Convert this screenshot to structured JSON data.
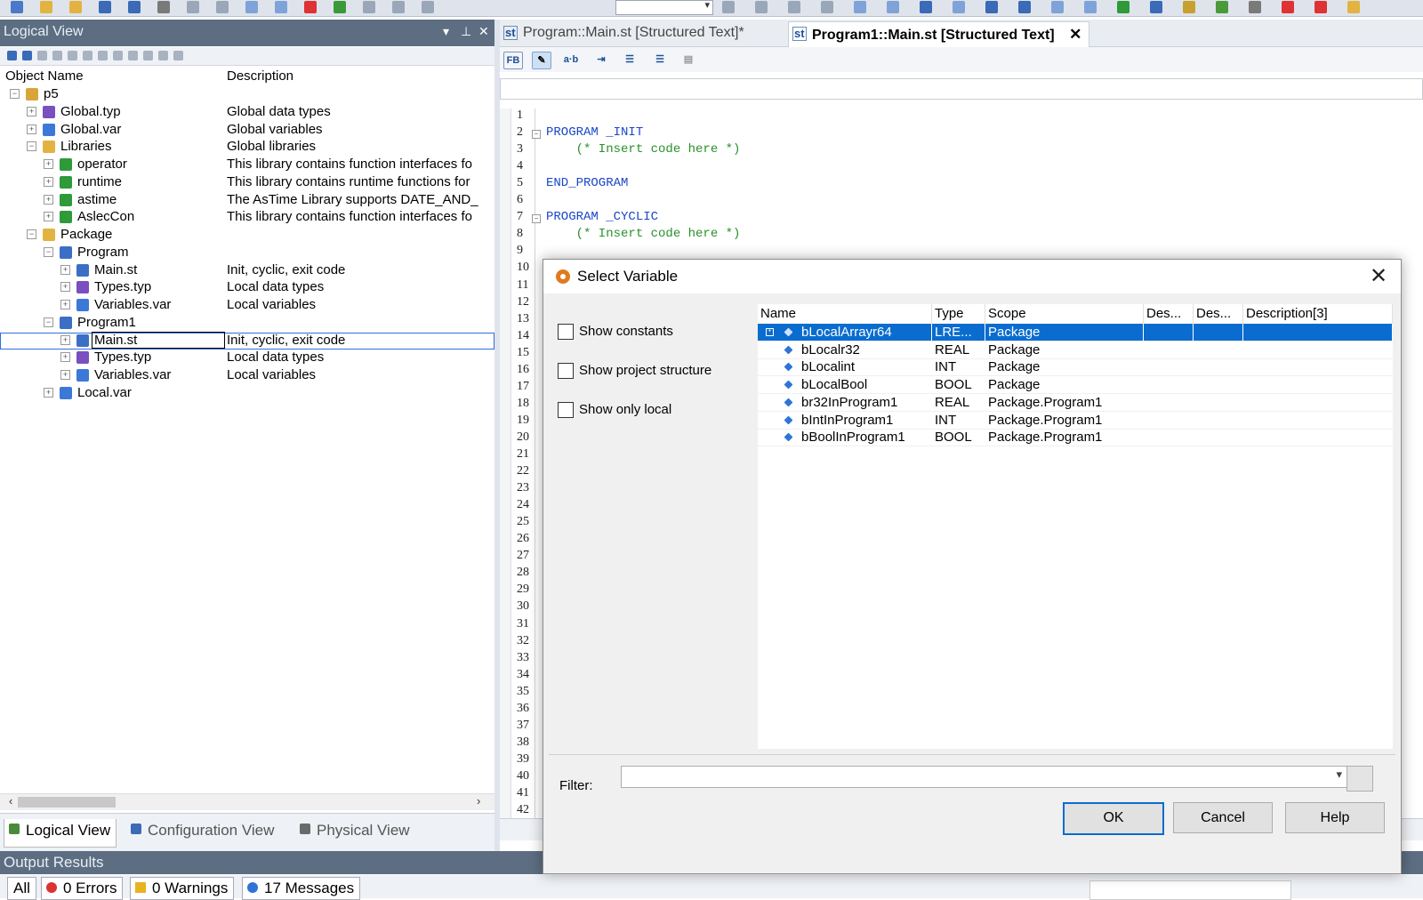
{
  "left_pane": {
    "title": "Logical View",
    "col_name": "Object Name",
    "col_desc": "Description",
    "tree": [
      {
        "name": "p5",
        "desc": "",
        "indent": 0,
        "icon": "project-icon",
        "color": "#d9a53a"
      },
      {
        "name": "Global.typ",
        "desc": "Global data types",
        "indent": 1,
        "icon": "datatype-icon",
        "color": "#7a4fc0"
      },
      {
        "name": "Global.var",
        "desc": "Global variables",
        "indent": 1,
        "icon": "variable-file-icon",
        "color": "#3c78d8"
      },
      {
        "name": "Libraries",
        "desc": "Global libraries",
        "indent": 1,
        "icon": "folder-icon",
        "color": "#e3b341"
      },
      {
        "name": "operator",
        "desc": "This library contains function interfaces fo",
        "indent": 2,
        "icon": "library-icon",
        "color": "#2e9a3a"
      },
      {
        "name": "runtime",
        "desc": "This library contains runtime functions for",
        "indent": 2,
        "icon": "library-icon",
        "color": "#2e9a3a"
      },
      {
        "name": "astime",
        "desc": "The AsTime Library supports DATE_AND_",
        "indent": 2,
        "icon": "library-icon",
        "color": "#2e9a3a"
      },
      {
        "name": "AslecCon",
        "desc": "This library contains function interfaces fo",
        "indent": 2,
        "icon": "library-icon",
        "color": "#2e9a3a"
      },
      {
        "name": "Package",
        "desc": "",
        "indent": 1,
        "icon": "folder-icon",
        "color": "#e3b341"
      },
      {
        "name": "Program",
        "desc": "",
        "indent": 2,
        "icon": "program-icon",
        "color": "#3b6fc6"
      },
      {
        "name": "Main.st",
        "desc": "Init, cyclic, exit code",
        "indent": 3,
        "icon": "source-file-icon",
        "color": "#3b6fc6"
      },
      {
        "name": "Types.typ",
        "desc": "Local data types",
        "indent": 3,
        "icon": "datatype-icon",
        "color": "#7a4fc0"
      },
      {
        "name": "Variables.var",
        "desc": "Local variables",
        "indent": 3,
        "icon": "variable-file-icon",
        "color": "#3c78d8"
      },
      {
        "name": "Program1",
        "desc": "",
        "indent": 2,
        "icon": "program-icon",
        "color": "#3b6fc6"
      },
      {
        "name": "Main.st",
        "desc": "Init, cyclic, exit code",
        "indent": 3,
        "icon": "source-file-icon",
        "color": "#3b6fc6",
        "selected": true
      },
      {
        "name": "Types.typ",
        "desc": "Local data types",
        "indent": 3,
        "icon": "datatype-icon",
        "color": "#7a4fc0"
      },
      {
        "name": "Variables.var",
        "desc": "Local variables",
        "indent": 3,
        "icon": "variable-file-icon",
        "color": "#3c78d8"
      },
      {
        "name": "Local.var",
        "desc": "",
        "indent": 2,
        "icon": "variable-file-icon",
        "color": "#3c78d8"
      }
    ],
    "tabs": [
      "Logical View",
      "Configuration View",
      "Physical View"
    ]
  },
  "editor": {
    "tabs": [
      {
        "label": "Program::Main.st [Structured Text]*",
        "badge": "st"
      },
      {
        "label": "Program1::Main.st [Structured Text]",
        "badge": "st"
      }
    ],
    "toolbar_fb": "FB",
    "toolbar_ab": "a·b",
    "line_count": 42,
    "code_lines": [
      {
        "n": 2,
        "kw": "PROGRAM _INIT",
        "cm": ""
      },
      {
        "n": 3,
        "kw": "",
        "cm": "    (* Insert code here *)"
      },
      {
        "n": 5,
        "kw": "END_PROGRAM",
        "cm": ""
      },
      {
        "n": 7,
        "kw": "PROGRAM _CYCLIC",
        "cm": ""
      },
      {
        "n": 8,
        "kw": "",
        "cm": "    (* Insert code here *)"
      }
    ]
  },
  "dialog": {
    "title": "Select Variable",
    "options": [
      "Show constants",
      "Show project structure",
      "Show only local"
    ],
    "columns": [
      "Name",
      "Type",
      "Scope",
      "Des...",
      "Des...",
      "Description[3]"
    ],
    "rows": [
      {
        "name": "bLocalArrayr64",
        "type": "LRE...",
        "scope": "Package",
        "selected": true
      },
      {
        "name": "bLocalr32",
        "type": "REAL",
        "scope": "Package"
      },
      {
        "name": "bLocalint",
        "type": "INT",
        "scope": "Package"
      },
      {
        "name": "bLocalBool",
        "type": "BOOL",
        "scope": "Package"
      },
      {
        "name": "br32InProgram1",
        "type": "REAL",
        "scope": "Package.Program1"
      },
      {
        "name": "bIntInProgram1",
        "type": "INT",
        "scope": "Package.Program1"
      },
      {
        "name": "bBoolInProgram1",
        "type": "BOOL",
        "scope": "Package.Program1"
      }
    ],
    "filter_label": "Filter:",
    "filter_value": "",
    "ok": "OK",
    "cancel": "Cancel",
    "help": "Help"
  },
  "output": {
    "title": "Output Results",
    "all": "All",
    "errors": "0 Errors",
    "warnings": "0 Warnings",
    "messages": "17 Messages"
  },
  "colors": {
    "selection": "#0a6ccf",
    "keyword": "#1a46c8",
    "comment": "#2a8f2a",
    "panel_title": "#5d6e82"
  }
}
